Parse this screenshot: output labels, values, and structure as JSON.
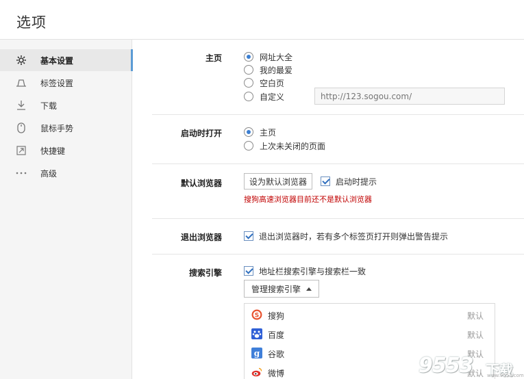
{
  "window": {
    "title": "选项"
  },
  "sidebar": {
    "items": [
      {
        "label": "基本设置",
        "icon": "gear-icon",
        "active": true
      },
      {
        "label": "标签设置",
        "icon": "tab-icon",
        "active": false
      },
      {
        "label": "下载",
        "icon": "download-icon",
        "active": false
      },
      {
        "label": "鼠标手势",
        "icon": "mouse-icon",
        "active": false
      },
      {
        "label": "快捷键",
        "icon": "shortcut-icon",
        "active": false
      },
      {
        "label": "高级",
        "icon": "more-icon",
        "active": false
      }
    ]
  },
  "homepage": {
    "label": "主页",
    "options": [
      "网址大全",
      "我的最爱",
      "空白页",
      "自定义"
    ],
    "selected": "网址大全",
    "custom_url_placeholder": "http://123.sogou.com/"
  },
  "startup": {
    "label": "启动时打开",
    "options": [
      "主页",
      "上次未关闭的页面"
    ],
    "selected": "主页"
  },
  "default_browser": {
    "label": "默认浏览器",
    "set_button": "设为默认浏览器",
    "prompt_checkbox": "启动时提示",
    "prompt_checked": true,
    "warning": "搜狗高速浏览器目前还不是默认浏览器"
  },
  "exit_browser": {
    "label": "退出浏览器",
    "checkbox": "退出浏览器时，若有多个标签页打开则弹出警告提示",
    "checked": true
  },
  "search_engine": {
    "label": "搜索引擎",
    "sync_checkbox": "地址栏搜索引擎与搜索栏一致",
    "sync_checked": true,
    "manage_button": "管理搜索引擎",
    "engines": [
      {
        "name": "搜狗",
        "status": "默认",
        "icon": "sogou-icon",
        "color": "#e8522e"
      },
      {
        "name": "百度",
        "status": "默认",
        "icon": "baidu-icon",
        "color": "#2f5fd6"
      },
      {
        "name": "谷歌",
        "status": "默认",
        "icon": "google-icon",
        "color": "#3f7fd9"
      },
      {
        "name": "微博",
        "status": "默认",
        "icon": "weibo-icon",
        "color": "#e0312b"
      }
    ]
  },
  "watermark": {
    "number": "9553",
    "text": "下载",
    "site": "www.9553.com"
  }
}
